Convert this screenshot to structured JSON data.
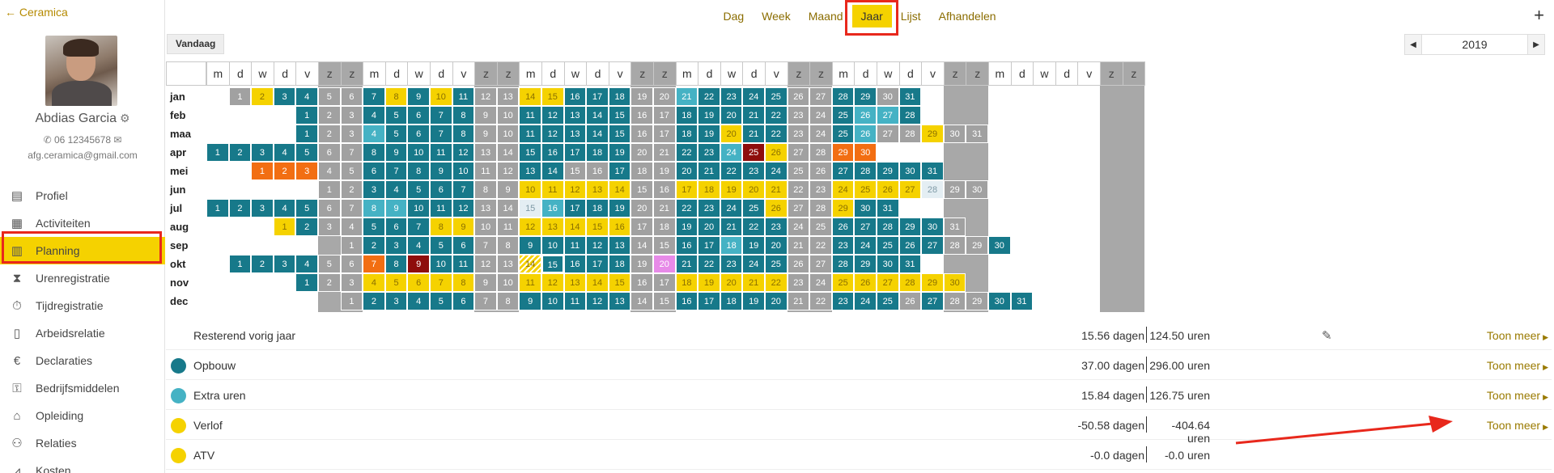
{
  "sidebar": {
    "back_label": "← Ceramica",
    "user_name": "Abdias Garcia",
    "user_phone": "✆ 06 12345678 ✉",
    "user_email": "afg.ceramica@gmail.com",
    "items": [
      {
        "label": "Profiel",
        "icon": "id-card-icon",
        "glyph": "▤"
      },
      {
        "label": "Activiteiten",
        "icon": "table-icon",
        "glyph": "▦"
      },
      {
        "label": "Planning",
        "icon": "calendar-icon",
        "glyph": "▥",
        "active": true
      },
      {
        "label": "Urenregistratie",
        "icon": "hourglass-icon",
        "glyph": "⧗"
      },
      {
        "label": "Tijdregistratie",
        "icon": "stopwatch-icon",
        "glyph": "⏱"
      },
      {
        "label": "Arbeidsrelatie",
        "icon": "contract-icon",
        "glyph": "▯"
      },
      {
        "label": "Declaraties",
        "icon": "euro-icon",
        "glyph": "€"
      },
      {
        "label": "Bedrijfsmiddelen",
        "icon": "key-icon",
        "glyph": "⚿"
      },
      {
        "label": "Opleiding",
        "icon": "graduation-icon",
        "glyph": "⌂"
      },
      {
        "label": "Relaties",
        "icon": "people-icon",
        "glyph": "⚇"
      },
      {
        "label": "Kosten",
        "icon": "chart-icon",
        "glyph": "⩘"
      }
    ]
  },
  "tabs": [
    {
      "label": "Dag"
    },
    {
      "label": "Week"
    },
    {
      "label": "Maand"
    },
    {
      "label": "Jaar",
      "active": true
    },
    {
      "label": "Lijst"
    },
    {
      "label": "Afhandelen"
    }
  ],
  "toolbar": {
    "today_label": "Vandaag",
    "year": "2019",
    "add_label": "+"
  },
  "calendar": {
    "day_headers": [
      "m",
      "d",
      "w",
      "d",
      "v",
      "z",
      "z",
      "m",
      "d",
      "w",
      "d",
      "v",
      "z",
      "z",
      "m",
      "d",
      "w",
      "d",
      "v",
      "z",
      "z",
      "m",
      "d",
      "w",
      "d",
      "v",
      "z",
      "z",
      "m",
      "d",
      "w",
      "d",
      "v",
      "z",
      "z",
      "m",
      "d",
      "w",
      "d",
      "v",
      "z",
      "z"
    ],
    "months": [
      "jan",
      "feb",
      "maa",
      "apr",
      "mei",
      "jun",
      "jul",
      "aug",
      "sep",
      "okt",
      "nov",
      "dec"
    ],
    "month_offsets": [
      1,
      4,
      4,
      0,
      2,
      5,
      0,
      3,
      6,
      1,
      4,
      6
    ],
    "month_lengths": [
      31,
      28,
      31,
      30,
      31,
      30,
      31,
      31,
      30,
      31,
      30,
      31
    ],
    "colors": {
      "teal": "#17798a",
      "gray": "#a1a1a1",
      "yellow": "#f5d200",
      "lteal": "#45b2c4",
      "orange": "#f26e12",
      "dred": "#8e0d0b",
      "violet": "#e78ae8",
      "highlight": "#e8281c"
    },
    "day_status": {
      "jan": {
        "1": "gray",
        "2": "yellow",
        "8": "yellow",
        "10": "yellow",
        "14": "yellow",
        "15": "yellow",
        "21": "lteal",
        "30": "gray",
        "31": "teal"
      },
      "feb": {
        "26": "lteal",
        "27": "lteal"
      },
      "maa": {
        "4": "lteal",
        "20": "yellow",
        "26": "lteal",
        "27": "gray",
        "28": "gray",
        "29": "yellow"
      },
      "apr": {
        "24": "lteal",
        "25": "dred",
        "26": "yellow",
        "29": "orange",
        "30": "orange"
      },
      "mei": {
        "1": "orange",
        "2": "orange",
        "3": "orange",
        "15": "gray",
        "16": "gray"
      },
      "jun": {
        "10": "yellow",
        "11": "yellow",
        "12": "yellow",
        "13": "yellow",
        "14": "yellow",
        "17": "yellow",
        "18": "yellow",
        "19": "yellow",
        "20": "yellow",
        "21": "yellow",
        "24": "yellow",
        "25": "yellow",
        "26": "yellow",
        "27": "yellow",
        "28": "lgray"
      },
      "jul": {
        "8": "lteal",
        "9": "lteal",
        "15": "lgray",
        "16": "lteal",
        "26": "yellow",
        "29": "yellow"
      },
      "aug": {
        "1": "yellow",
        "8": "yellow",
        "9": "yellow",
        "12": "yellow",
        "13": "yellow",
        "14": "yellow",
        "15": "yellow",
        "16": "yellow"
      },
      "sep": {
        "18": "lteal"
      },
      "okt": {
        "7": "orange",
        "9": "dred",
        "14": "hatch",
        "15": "teal-white",
        "20": "violet"
      },
      "nov": {
        "4": "yellow",
        "5": "yellow",
        "6": "yellow",
        "7": "yellow",
        "8": "yellow",
        "11": "yellow",
        "12": "yellow",
        "13": "yellow",
        "14": "yellow",
        "15": "yellow",
        "18": "yellow",
        "19": "yellow",
        "20": "yellow",
        "21": "yellow",
        "22": "yellow",
        "25": "yellow",
        "26": "yellow",
        "27": "yellow",
        "28": "yellow",
        "29": "yellow",
        "30": "yellow"
      },
      "dec": {
        "26": "gray"
      }
    }
  },
  "summary": [
    {
      "label": "Resterend vorig jaar",
      "days": "15.56 dagen",
      "hours": "124.50 uren",
      "more": "Toon meer",
      "editable": true
    },
    {
      "label": "Opbouw",
      "color": "#17798a",
      "days": "37.00 dagen",
      "hours": "296.00 uren",
      "more": "Toon meer"
    },
    {
      "label": "Extra uren",
      "color": "#45b2c4",
      "days": "15.84 dagen",
      "hours": "126.75 uren",
      "more": "Toon meer"
    },
    {
      "label": "Verlof",
      "color": "#f5d200",
      "days": "-50.58 dagen",
      "hours": "-404.64 uren",
      "more": "Toon meer"
    },
    {
      "label": "ATV",
      "color": "#f5d200",
      "days": "-0.0 dagen",
      "hours": "-0.0 uren",
      "more": ""
    }
  ]
}
